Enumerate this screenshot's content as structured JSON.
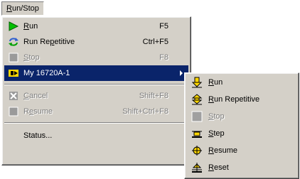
{
  "menubar": {
    "title_prefix": "R",
    "title_rest": "un/Stop"
  },
  "main_menu": [
    {
      "name": "run",
      "pre": "",
      "key": "R",
      "post": "un",
      "shortcut": "F5",
      "enabled": true,
      "icon": "green-play-icon"
    },
    {
      "name": "run-repetitive",
      "pre": "Run Re",
      "key": "p",
      "post": "etitive",
      "shortcut": "Ctrl+F5",
      "enabled": true,
      "icon": "repeat-arrows-icon"
    },
    {
      "name": "stop",
      "pre": "",
      "key": "S",
      "post": "top",
      "shortcut": "F8",
      "enabled": false,
      "icon": "stop-square-icon"
    },
    {
      "name": "my-16720a-1",
      "pre": "My 16720A-1",
      "key": "",
      "post": "",
      "shortcut": "",
      "enabled": true,
      "selected": true,
      "icon": "module-run-icon"
    },
    {
      "name": "cancel",
      "pre": "",
      "key": "C",
      "post": "ancel",
      "shortcut": "Shift+F8",
      "enabled": false,
      "icon": "cancel-x-icon"
    },
    {
      "name": "resume",
      "pre": "R",
      "key": "e",
      "post": "sume",
      "shortcut": "Shift+Ctrl+F8",
      "enabled": false,
      "icon": "resume-square-icon"
    },
    {
      "name": "status",
      "pre": "Status...",
      "key": "",
      "post": "",
      "shortcut": "",
      "enabled": true,
      "icon": ""
    }
  ],
  "sub_menu": [
    {
      "name": "run",
      "pre": "",
      "key": "R",
      "post": "un",
      "enabled": true,
      "icon": "run-down-arrow-icon"
    },
    {
      "name": "run-repetitive",
      "pre": "",
      "key": "R",
      "post": "un Repetitive",
      "enabled": true,
      "icon": "run-repetitive-icon"
    },
    {
      "name": "stop",
      "pre": "",
      "key": "S",
      "post": "top",
      "enabled": false,
      "icon": "stop-square-icon"
    },
    {
      "name": "step",
      "pre": "",
      "key": "S",
      "post": "tep",
      "enabled": true,
      "icon": "step-icon"
    },
    {
      "name": "resume",
      "pre": "",
      "key": "R",
      "post": "esume",
      "enabled": true,
      "icon": "resume-icon"
    },
    {
      "name": "reset",
      "pre": "",
      "key": "R",
      "post": "eset",
      "enabled": true,
      "icon": "reset-icon"
    }
  ],
  "colors": {
    "menu_bg": "#d4d0c8",
    "highlight": "#0a246a",
    "icon_yellow": "#ffd700",
    "icon_green": "#00c000"
  }
}
